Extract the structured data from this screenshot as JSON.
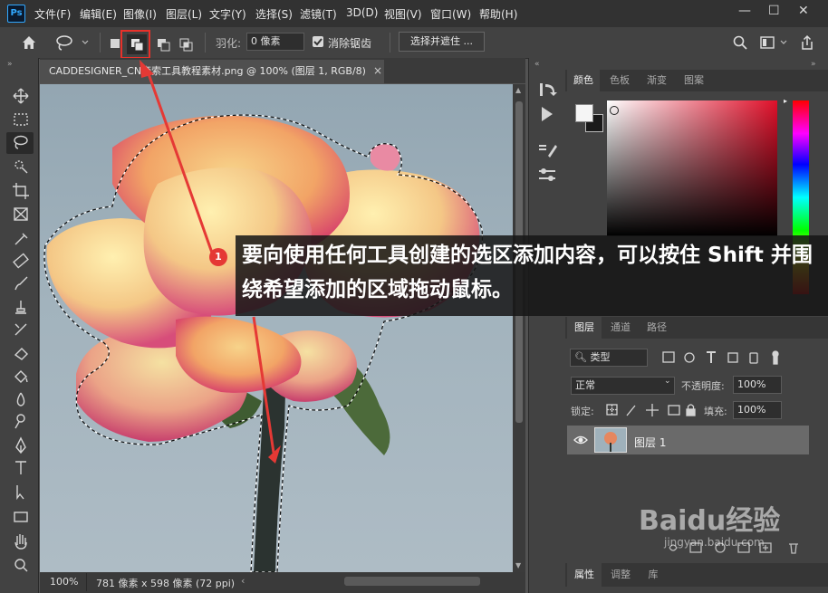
{
  "app": {
    "logo": "Ps"
  },
  "menu": [
    "文件(F)",
    "编辑(E)",
    "图像(I)",
    "图层(L)",
    "文字(Y)",
    "选择(S)",
    "滤镜(T)",
    "3D(D)",
    "视图(V)",
    "窗口(W)",
    "帮助(H)"
  ],
  "window_controls": {
    "minimize": "—",
    "restore": "☐",
    "close": "✕"
  },
  "options": {
    "feather_label": "羽化:",
    "feather_value": "0 像素",
    "antialias_label": "消除锯齿",
    "antialias_checked": true,
    "select_mask_button": "选择并遮住 ..."
  },
  "document": {
    "tab_title": "CADDESIGNER_CN套索工具教程素材.png @ 100% (图层 1, RGB/8)",
    "tab_close": "×",
    "zoom": "100%",
    "dimensions": "781 像素 x 598 像素 (72 ppi)"
  },
  "color_panel": {
    "tabs": [
      "颜色",
      "色板",
      "渐变",
      "图案"
    ],
    "active": 0,
    "fg": "#f5f5f5",
    "bg": "#1a1a1a"
  },
  "layers_panel": {
    "tabs": [
      "图层",
      "通道",
      "路径"
    ],
    "filter_kind": "类型",
    "blend_mode": "正常",
    "opacity_label": "不透明度:",
    "opacity_value": "100%",
    "lock_label": "锁定:",
    "fill_label": "填充:",
    "fill_value": "100%",
    "layers": [
      {
        "name": "图层 1",
        "visible": true
      }
    ]
  },
  "properties_panel": {
    "tabs": [
      "属性",
      "调整",
      "库"
    ]
  },
  "callout": {
    "badge": "1",
    "text": "要向使用任何工具创建的选区添加内容，可以按住 Shift 并围绕希望添加的区域拖动鼠标。"
  },
  "watermark": {
    "brand": "Baidu经验",
    "url": "jingyan.baidu.com"
  },
  "accent": {
    "highlight": "#e8312a",
    "ps_blue": "#31a8ff"
  },
  "icons": {
    "home": "home-icon",
    "lasso": "lasso-icon",
    "zoom": "search-icon",
    "share": "share-icon",
    "eye": "eye-icon"
  }
}
